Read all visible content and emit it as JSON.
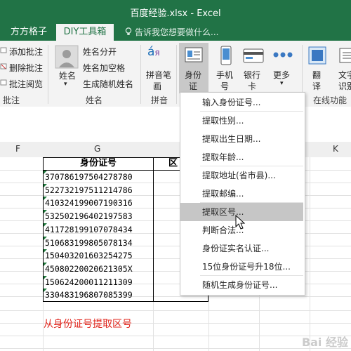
{
  "window": {
    "title": "百度经验.xlsx - Excel"
  },
  "tabs": [
    "方方格子",
    "DIY工具箱"
  ],
  "search": {
    "placeholder": "告诉我您想要做什么..."
  },
  "ribbon": {
    "comment_group": {
      "items": [
        "添加批注",
        "删除批注",
        "批注阅览"
      ],
      "label": "批注"
    },
    "name_group": {
      "big_button": "姓名",
      "items": [
        "姓名分开",
        "姓名加空格",
        "生成随机姓名"
      ],
      "label": "姓名"
    },
    "pinyin_group": {
      "button_line1": "拼音笔",
      "button_line2": "画",
      "label": "拼音"
    },
    "id_button": {
      "line1": "身份",
      "line2": "证"
    },
    "phone_button": {
      "line1": "手机",
      "line2": "号"
    },
    "bank_button": {
      "line1": "银行",
      "line2": "卡"
    },
    "more_button": {
      "line1": "更多"
    },
    "translate_button": {
      "line1": "翻",
      "line2": "译"
    },
    "ocr_button": {
      "line1": "文字",
      "line2": "识别"
    },
    "online_group_label": "在线功能"
  },
  "columns": [
    "F",
    "G",
    "K"
  ],
  "sheet": {
    "header_g": "身份证号",
    "header_h_partial": "区",
    "ids": [
      "370786197504278780",
      "522732197511214786",
      "410324199007190316",
      "532502196402197583",
      "411728199107078434",
      "510683199805078134",
      "150403201603254275",
      "45080220020621305X",
      "150624200011211309",
      "330483196807085399"
    ],
    "caption": "从身份证号提取区号"
  },
  "menu": {
    "items": [
      "输入身份证号...",
      "提取性别...",
      "提取出生日期...",
      "提取年龄...",
      "提取地址(省市县)...",
      "提取邮编...",
      "提取区号...",
      "判断合法...",
      "身份证实名认证...",
      "15位身份证号升18位...",
      "随机生成身份证号..."
    ],
    "highlighted_index": 6
  },
  "watermark": "Bai 经验",
  "colors": {
    "excel_green": "#217346",
    "caption_red": "#e0241b",
    "menu_highlight": "#c6c6c6"
  }
}
